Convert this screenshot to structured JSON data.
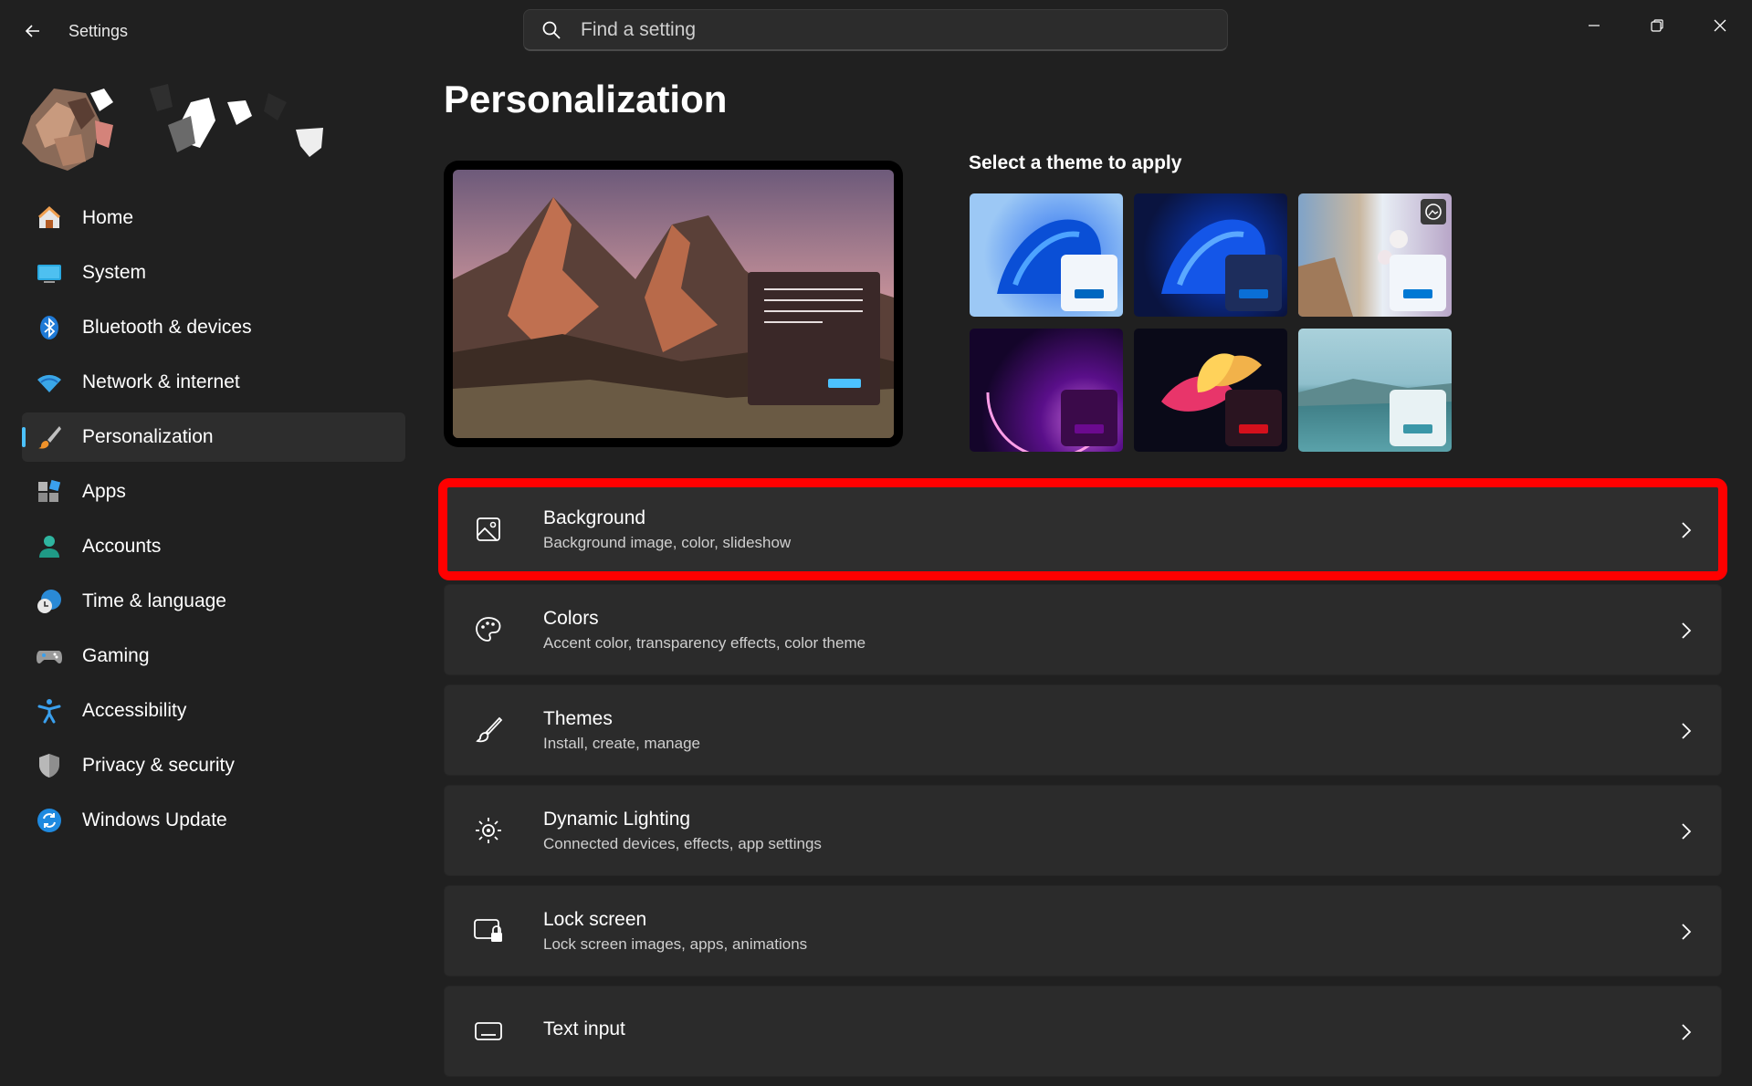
{
  "app": {
    "title": "Settings"
  },
  "search": {
    "placeholder": "Find a setting"
  },
  "window_controls": [
    "minimize",
    "maximize",
    "close"
  ],
  "nav": {
    "items": [
      {
        "label": "Home",
        "icon": "home-icon",
        "active": false
      },
      {
        "label": "System",
        "icon": "system-icon",
        "active": false
      },
      {
        "label": "Bluetooth & devices",
        "icon": "bluetooth-icon",
        "active": false
      },
      {
        "label": "Network & internet",
        "icon": "wifi-icon",
        "active": false
      },
      {
        "label": "Personalization",
        "icon": "brush-icon",
        "active": true
      },
      {
        "label": "Apps",
        "icon": "apps-icon",
        "active": false
      },
      {
        "label": "Accounts",
        "icon": "account-icon",
        "active": false
      },
      {
        "label": "Time & language",
        "icon": "time-language-icon",
        "active": false
      },
      {
        "label": "Gaming",
        "icon": "gamepad-icon",
        "active": false
      },
      {
        "label": "Accessibility",
        "icon": "accessibility-icon",
        "active": false
      },
      {
        "label": "Privacy & security",
        "icon": "shield-icon",
        "active": false
      },
      {
        "label": "Windows Update",
        "icon": "update-icon",
        "active": false
      }
    ]
  },
  "main": {
    "title": "Personalization",
    "theme_heading": "Select a theme to apply",
    "themes": [
      {
        "name": "windows-light",
        "accent": "#0067c0"
      },
      {
        "name": "windows-dark",
        "accent": "#0a6fd6"
      },
      {
        "name": "spotlight",
        "accent": "#0078d4"
      },
      {
        "name": "glow",
        "accent": "#6b0a8f"
      },
      {
        "name": "captured-motion",
        "accent": "#d4101c"
      },
      {
        "name": "flow",
        "accent": "#3a97a8"
      }
    ],
    "cards": [
      {
        "title": "Background",
        "desc": "Background image, color, slideshow",
        "icon": "image-icon",
        "highlighted": true
      },
      {
        "title": "Colors",
        "desc": "Accent color, transparency effects, color theme",
        "icon": "palette-icon",
        "highlighted": false
      },
      {
        "title": "Themes",
        "desc": "Install, create, manage",
        "icon": "brush-icon",
        "highlighted": false
      },
      {
        "title": "Dynamic Lighting",
        "desc": "Connected devices, effects, app settings",
        "icon": "lighting-icon",
        "highlighted": false
      },
      {
        "title": "Lock screen",
        "desc": "Lock screen images, apps, animations",
        "icon": "lock-screen-icon",
        "highlighted": false
      },
      {
        "title": "Text input",
        "desc": "",
        "icon": "keyboard-icon",
        "highlighted": false
      }
    ]
  },
  "colors": {
    "accent": "#4cc2ff",
    "highlight": "#ff0000"
  }
}
